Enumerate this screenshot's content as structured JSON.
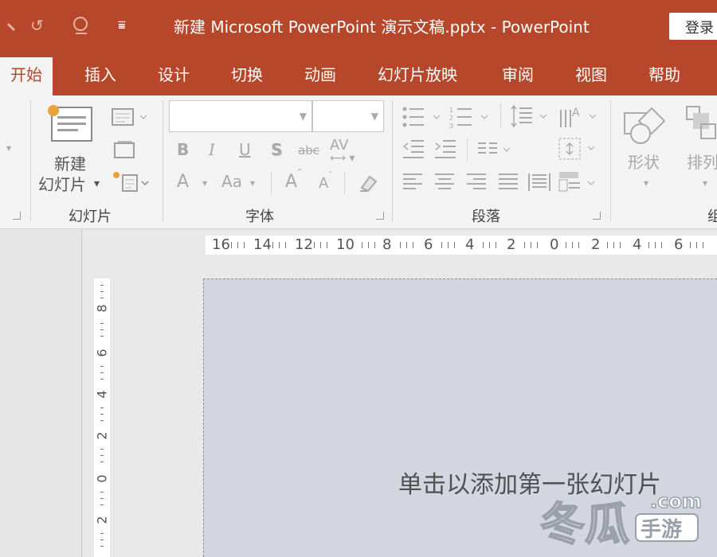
{
  "window": {
    "title": "新建 Microsoft PowerPoint 演示文稿.pptx  -  PowerPoint",
    "login_label": "登录"
  },
  "qat": {
    "save_glyph": "✓",
    "undo_glyph": "↺",
    "customize_glyph": "₹"
  },
  "tabs": [
    {
      "label": "开始",
      "active": true
    },
    {
      "label": "插入"
    },
    {
      "label": "设计"
    },
    {
      "label": "切换"
    },
    {
      "label": "动画"
    },
    {
      "label": "幻灯片放映"
    },
    {
      "label": "审阅"
    },
    {
      "label": "视图"
    },
    {
      "label": "帮助"
    }
  ],
  "ribbon": {
    "slides_group": {
      "label": "幻灯片",
      "new_slide_line1": "新建",
      "new_slide_line2": "幻灯片",
      "dropdown_glyph": "▾"
    },
    "font_group": {
      "label": "字体",
      "font_name_value": "",
      "font_size_value": "",
      "bold": "B",
      "italic": "I",
      "underline": "U",
      "shadow": "S",
      "strikethrough": "abc",
      "spacing": "AV",
      "font_color": "A",
      "change_case": "Aa",
      "grow_font": "A",
      "shrink_font": "A"
    },
    "paragraph_group": {
      "label": "段落"
    },
    "drawing_group": {
      "shapes_label": "形状",
      "arrange_label": "排列",
      "cut_label": "组"
    }
  },
  "ruler": {
    "horizontal": [
      "16",
      "14",
      "12",
      "10",
      "8",
      "6",
      "4",
      "2",
      "0",
      "2",
      "4",
      "6"
    ],
    "vertical": [
      "8",
      "6",
      "4",
      "2",
      "0",
      "2"
    ]
  },
  "slide": {
    "placeholder_text": "单击以添加第一张幻灯片"
  },
  "watermark": {
    "brand_big": "冬瓜",
    "brand_small": "手游",
    "brand_domain": ".com"
  },
  "colors": {
    "accent": "#b7472a",
    "ribbon_bg": "#f3f3f3",
    "slide_bg": "#d3d6de"
  }
}
